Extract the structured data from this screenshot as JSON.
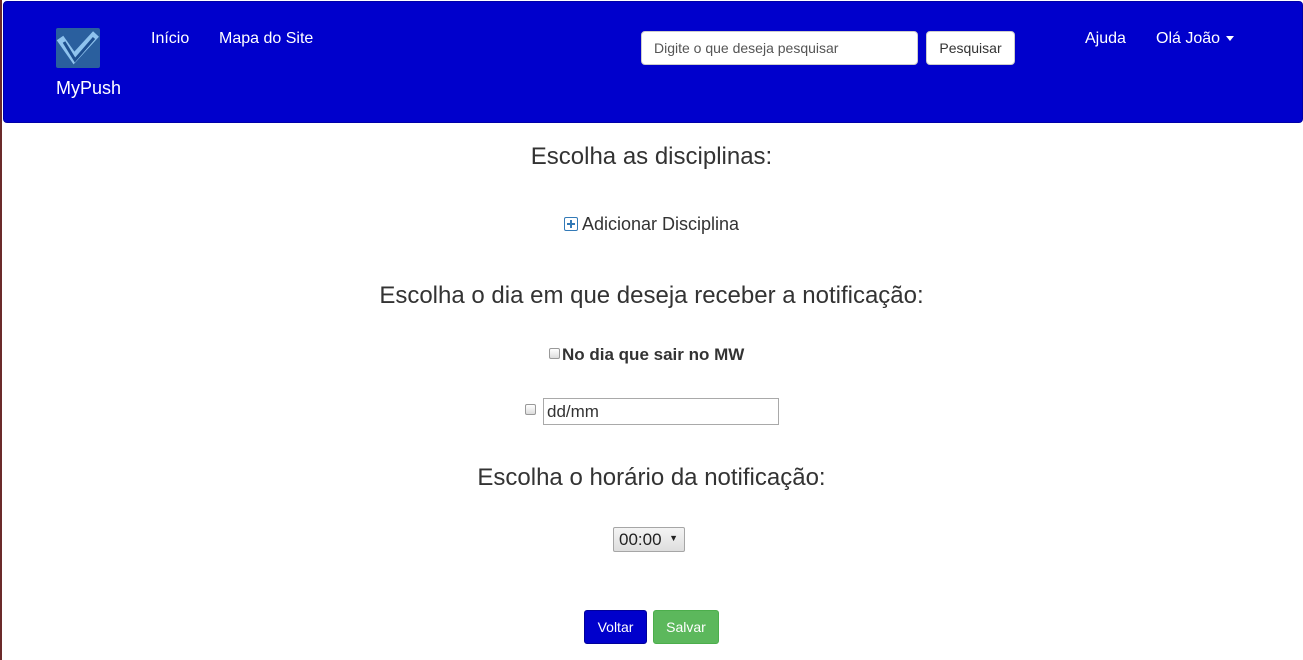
{
  "brand": {
    "name": "MyPush",
    "logo_icon": "mypush-check-logo-icon"
  },
  "nav": {
    "home_label": "Início",
    "sitemap_label": "Mapa do Site",
    "help_label": "Ajuda",
    "user_menu_label": "Olá João"
  },
  "search": {
    "placeholder": "Digite o que deseja pesquisar",
    "value": "",
    "button_label": "Pesquisar"
  },
  "sections": {
    "disciplines_heading": "Escolha as disciplinas:",
    "add_discipline_label": "Adicionar Disciplina",
    "day_heading": "Escolha o dia em que deseja receber a notificação:",
    "mw_option_label": "No dia que sair no MW",
    "date_placeholder": "dd/mm",
    "time_heading": "Escolha o horário da notificação:",
    "time_value": "00:00"
  },
  "actions": {
    "back_label": "Voltar",
    "save_label": "Salvar"
  },
  "colors": {
    "navbar": "#0000cc",
    "save": "#5cb85c",
    "back": "#0000cc"
  }
}
